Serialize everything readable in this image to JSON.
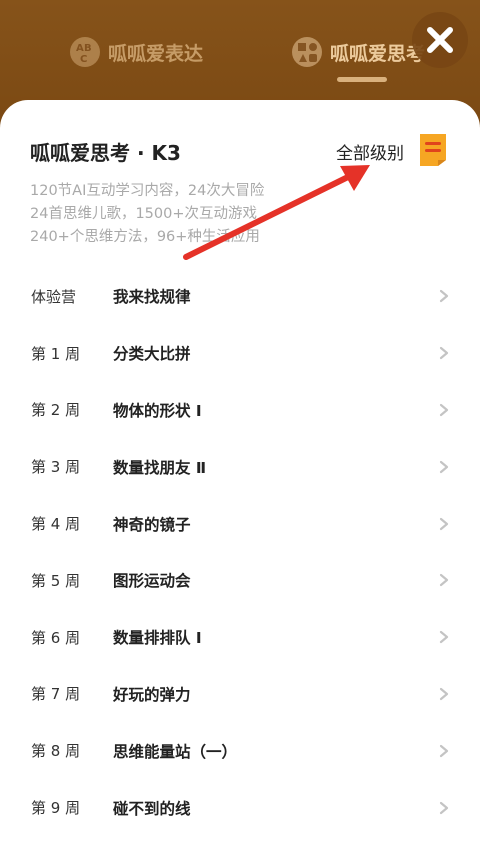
{
  "header": {
    "tabs": [
      {
        "label": "呱呱爱表达",
        "icon": "abc-icon"
      },
      {
        "label": "呱呱爱思考",
        "icon": "shapes-icon"
      }
    ]
  },
  "sheet": {
    "title": "呱呱爱思考 · K3",
    "level_label": "全部级别",
    "description": [
      "120节AI互动学习内容，24次大冒险",
      "24首思维儿歌，1500+次互动游戏",
      "240+个思维方法，96+种生活应用"
    ]
  },
  "lessons": [
    {
      "week": "体验营",
      "title": "我来找规律"
    },
    {
      "week": "第 1 周",
      "title": "分类大比拼"
    },
    {
      "week": "第 2 周",
      "title": "物体的形状 Ⅰ"
    },
    {
      "week": "第 3 周",
      "title": "数量找朋友 Ⅱ"
    },
    {
      "week": "第 4 周",
      "title": "神奇的镜子"
    },
    {
      "week": "第 5 周",
      "title": "图形运动会"
    },
    {
      "week": "第 6 周",
      "title": "数量排排队 Ⅰ"
    },
    {
      "week": "第 7 周",
      "title": "好玩的弹力"
    },
    {
      "week": "第 8 周",
      "title": "思维能量站（一）"
    },
    {
      "week": "第 9 周",
      "title": "碰不到的线"
    }
  ],
  "colors": {
    "header_bg": "#7a4812",
    "accent_orange": "#f6a623",
    "annotation_arrow": "#e53228"
  }
}
